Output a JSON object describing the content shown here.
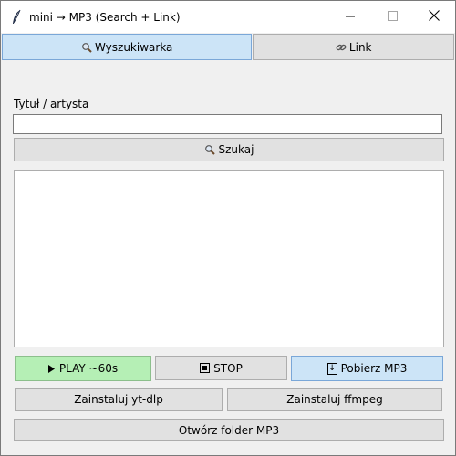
{
  "window": {
    "title": "mini → MP3 (Search + Link)",
    "icons": {
      "app": "feather-icon",
      "minimize": "minimize-icon",
      "maximize": "maximize-icon",
      "close": "close-icon"
    }
  },
  "tabs": [
    {
      "label": "Wyszukiwarka",
      "icon": "magnifier-icon",
      "active": true
    },
    {
      "label": "Link",
      "icon": "link-icon",
      "active": false
    }
  ],
  "search": {
    "label": "Tytuł / artysta",
    "value": "",
    "button_label": "Szukaj",
    "button_icon": "magnifier-icon"
  },
  "results": [],
  "actions": {
    "play_label": "PLAY ~60s",
    "play_icon": "play-triangle-icon",
    "stop_label": "STOP",
    "stop_icon": "stop-square-icon",
    "download_label": "Pobierz MP3",
    "download_icon": "download-arrow-icon"
  },
  "tools": {
    "ytdlp_label": "Zainstaluj yt-dlp",
    "ffmpeg_label": "Zainstaluj ffmpeg",
    "folder_label": "Otwórz folder MP3"
  },
  "colors": {
    "active_tab": "#cce4f7",
    "play_button": "#b5efb5",
    "download_button": "#cce4f7",
    "button_default": "#e1e1e1"
  }
}
